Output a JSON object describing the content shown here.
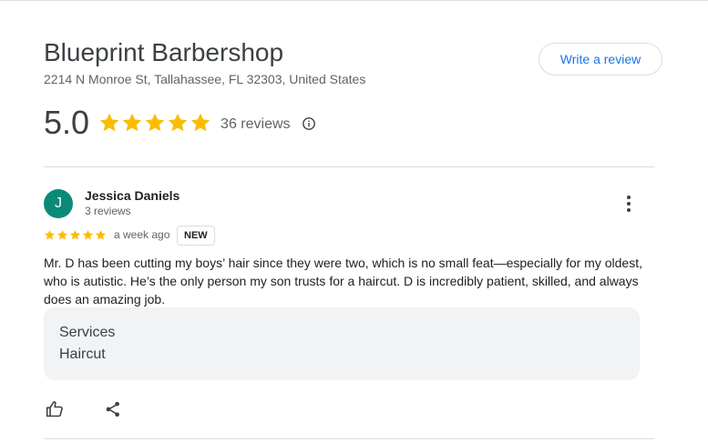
{
  "business": {
    "name": "Blueprint Barbershop",
    "address": "2214 N Monroe St, Tallahassee, FL 32303, United States"
  },
  "write_review_label": "Write a review",
  "rating": {
    "score": "5.0",
    "stars": 5,
    "count_label": "36 reviews"
  },
  "review": {
    "avatar_initial": "J",
    "author": "Jessica Daniels",
    "author_meta": "3 reviews",
    "stars": 5,
    "date": "a week ago",
    "badge": "NEW",
    "text": "Mr. D has been cutting my boys’ hair since they were two, which is no small feat—especially for my oldest, who is autistic. He’s the only person my son trusts for a haircut. D is incredibly patient, skilled, and always does an amazing job.",
    "services_label": "Services",
    "services_value": "Haircut"
  },
  "colors": {
    "star": "#fbbc04",
    "accent": "#1a73e8",
    "avatar": "#0b8a7a"
  },
  "icons": [
    "star-icon",
    "info-icon",
    "more-vert-icon",
    "thumb-up-icon",
    "share-icon"
  ]
}
